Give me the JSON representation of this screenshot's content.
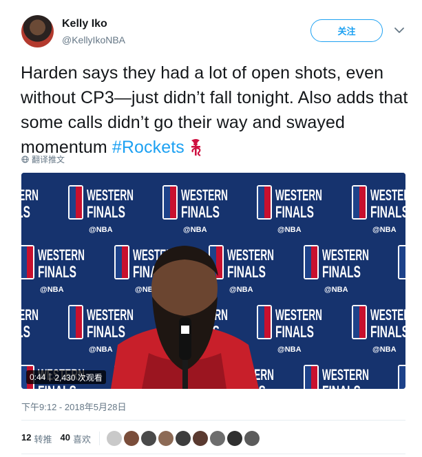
{
  "user": {
    "name": "Kelly Iko",
    "handle": "@KellyIkoNBA"
  },
  "follow_label": "关注",
  "tweet": {
    "text": "Harden says they had a lot of open shots, even without CP3—just didn’t fall tonight. Also adds that some calls didn’t go their way and swayed momentum ",
    "hashtag": "#Rockets"
  },
  "translate_label": "翻译推文",
  "video": {
    "duration": "0:44",
    "views": "2,430 次观看",
    "backdrop": {
      "western": "WESTERN",
      "finals": "FINALS",
      "league": "@NBA"
    }
  },
  "timestamp": "下午9:12 - 2018年5月28日",
  "stats": {
    "retweets_count": "12",
    "retweets_label": "转推",
    "likes_count": "40",
    "likes_label": "喜欢"
  },
  "liker_colors": [
    "#c9c9c9",
    "#7a4d3a",
    "#4a4a4a",
    "#8c6a55",
    "#3d3d3d",
    "#5a3a30",
    "#6d6d6d",
    "#2f2f2f",
    "#5b5b5b"
  ],
  "colors": {
    "accent": "#1da1f2",
    "rockets_red": "#ce1141",
    "backdrop_blue": "#16336e"
  }
}
